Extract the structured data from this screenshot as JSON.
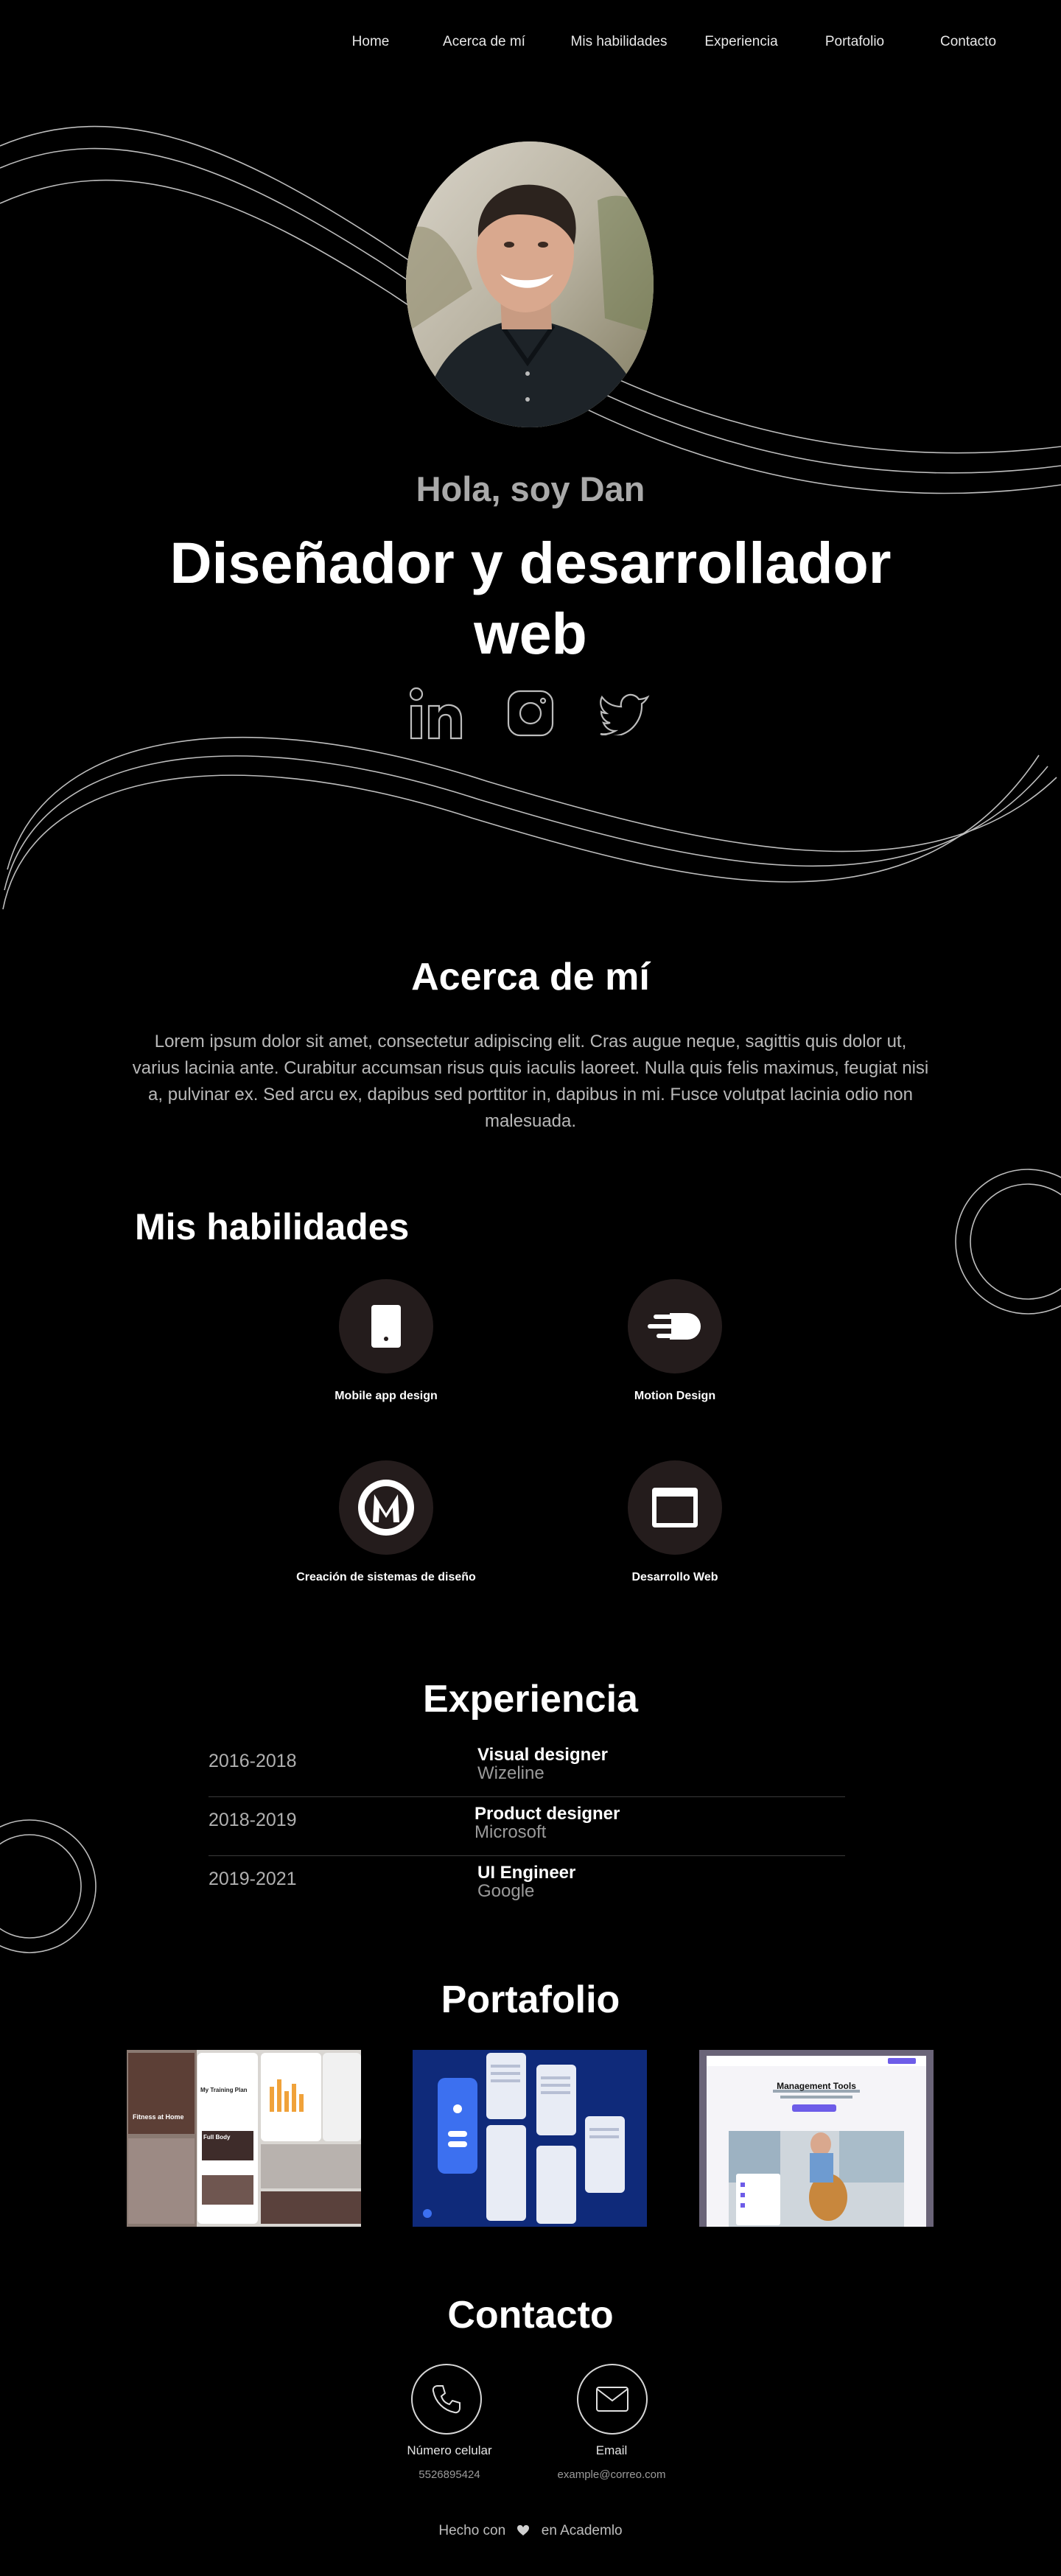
{
  "nav": {
    "items": [
      {
        "label": "Home"
      },
      {
        "label": "Acerca de mí"
      },
      {
        "label": "Mis habilidades"
      },
      {
        "label": "Experiencia"
      },
      {
        "label": "Portafolio"
      },
      {
        "label": "Contacto"
      }
    ]
  },
  "hero": {
    "greeting": "Hola, soy Dan",
    "headline": "Diseñador y desarrollador web",
    "social": [
      "linkedin-icon",
      "instagram-icon",
      "twitter-icon"
    ]
  },
  "about": {
    "title": "Acerca de mí",
    "text": "Lorem ipsum dolor sit amet, consectetur adipiscing elit. Cras augue neque, sagittis quis dolor ut, varius lacinia ante. Curabitur accumsan risus quis iaculis laoreet. Nulla quis felis maximus, feugiat nisi a, pulvinar ex. Sed arcu ex, dapibus sed porttitor in, dapibus in mi. Fusce volutpat lacinia odio non malesuada."
  },
  "skills": {
    "title": "Mis habilidades",
    "items": [
      {
        "label": "Mobile app design",
        "icon": "mobile-icon"
      },
      {
        "label": "Motion Design",
        "icon": "motion-icon"
      },
      {
        "label": "Creación de sistemas de diseño",
        "icon": "design-system-icon"
      },
      {
        "label": "Desarrollo Web",
        "icon": "browser-window-icon"
      }
    ]
  },
  "experience": {
    "title": "Experiencia",
    "items": [
      {
        "years": "2016-2018",
        "role": "Visual designer",
        "company": "Wizeline"
      },
      {
        "years": "2018-2019",
        "role": "Product designer",
        "company": "Microsoft"
      },
      {
        "years": "2019-2021",
        "role": "UI Engineer",
        "company": "Google"
      }
    ]
  },
  "portfolio": {
    "title": "Portafolio",
    "projects": [
      {
        "caption": "Fitness at Home",
        "sub": "My Training Plan",
        "extra": "Full Body"
      },
      {
        "caption": "",
        "sub": "",
        "extra": ""
      },
      {
        "caption": "Management Tools",
        "sub": "",
        "extra": ""
      }
    ]
  },
  "contact": {
    "title": "Contacto",
    "phone_label": "Número celular",
    "phone_value": "5526895424",
    "email_label": "Email",
    "email_value": "example@correo.com"
  },
  "footer": {
    "prefix": "Hecho con",
    "suffix": "en Academlo"
  },
  "colors": {
    "background": "#000000",
    "skill_circle": "#241c1c",
    "muted_text": "#b8b8b8"
  }
}
